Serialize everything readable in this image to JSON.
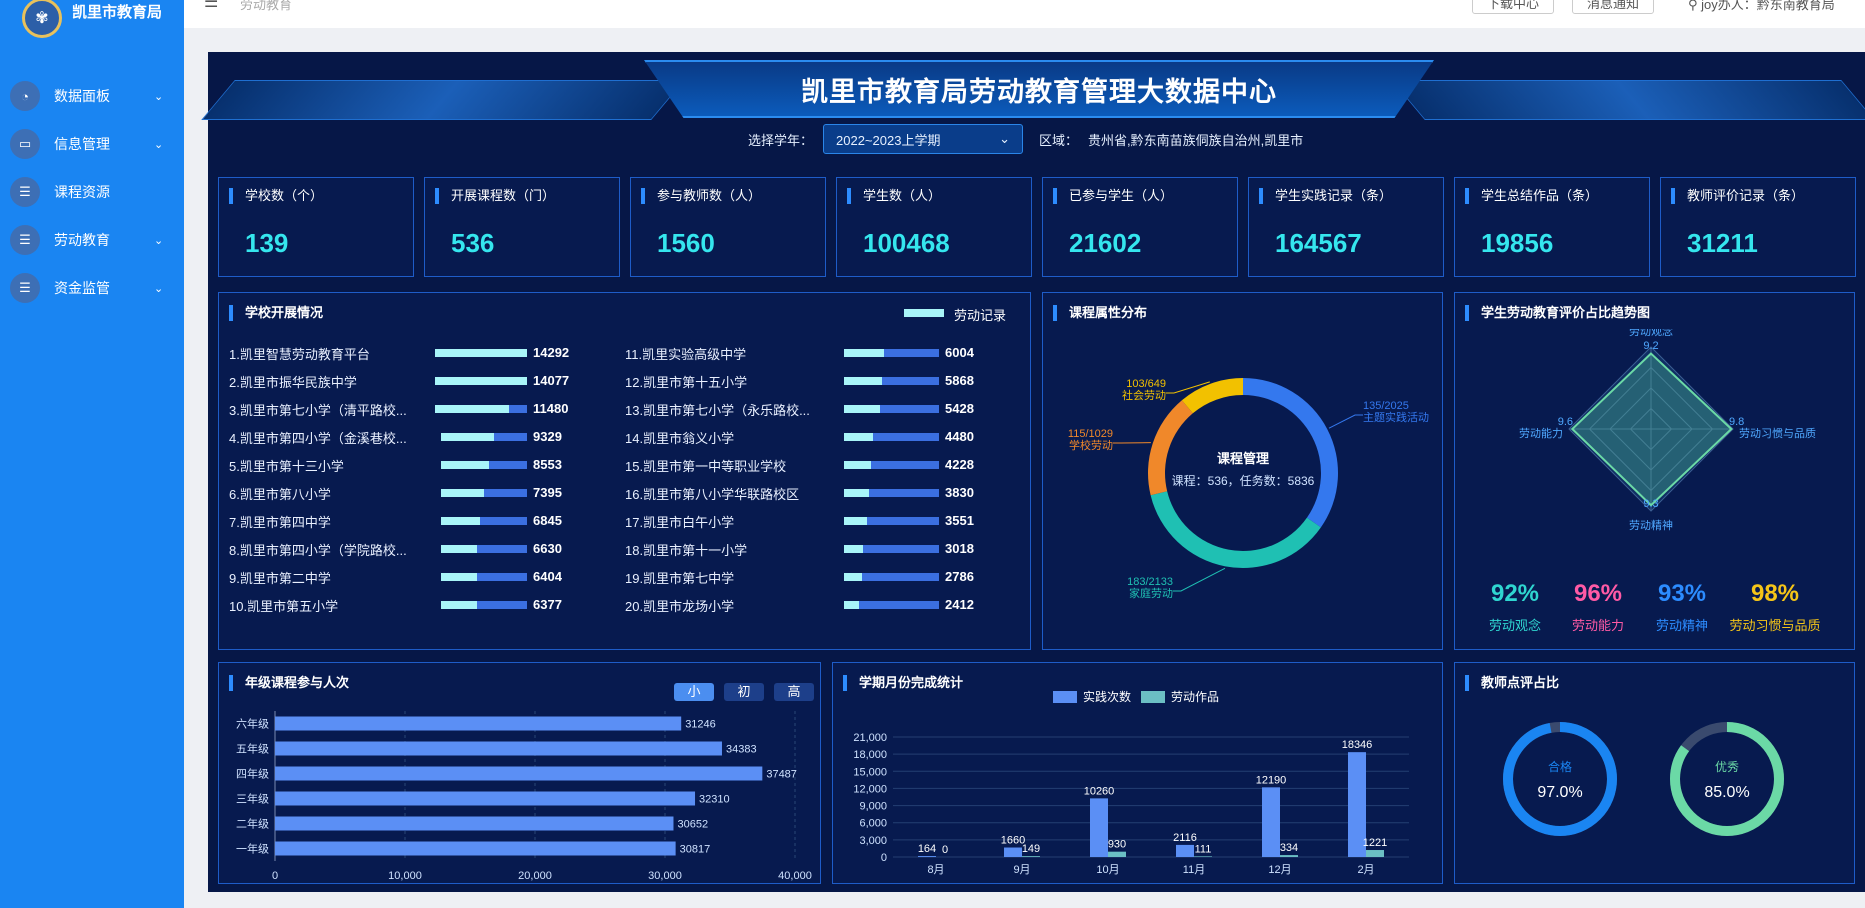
{
  "sidebar": {
    "logo_text": "凯里市教育局",
    "items": [
      {
        "label": "数据面板",
        "icon": "pie-chart-icon",
        "expandable": true
      },
      {
        "label": "信息管理",
        "icon": "monitor-icon",
        "expandable": true
      },
      {
        "label": "课程资源",
        "icon": "book-stack-icon",
        "expandable": false
      },
      {
        "label": "劳动教育",
        "icon": "book-stack-icon",
        "expandable": true
      },
      {
        "label": "资金监管",
        "icon": "book-stack-icon",
        "expandable": true
      }
    ]
  },
  "topbar": {
    "breadcrumb": "劳动教育",
    "download_label": "下载中心",
    "message_label": "消息通知",
    "user_label": "joy办人：黔东南教育局"
  },
  "header": {
    "title": "凯里市教育局劳动教育管理大数据中心",
    "year_label": "选择学年：",
    "year_value": "2022~2023上学期",
    "region_label": "区域：",
    "region_value": "贵州省,黔东南苗族侗族自治州,凯里市"
  },
  "stats": [
    {
      "label": "学校数（个）",
      "value": "139"
    },
    {
      "label": "开展课程数（门）",
      "value": "536"
    },
    {
      "label": "参与教师数（人）",
      "value": "1560"
    },
    {
      "label": "学生数（人）",
      "value": "100468"
    },
    {
      "label": "已参与学生（人）",
      "value": "21602"
    },
    {
      "label": "学生实践记录（条）",
      "value": "164567"
    },
    {
      "label": "学生总结作品（条）",
      "value": "19856"
    },
    {
      "label": "教师评价记录（条）",
      "value": "31211"
    }
  ],
  "school_panel": {
    "title": "学校开展情况",
    "legend": "劳动记录",
    "rows": [
      {
        "name": "1.凯里智慧劳动教育平台",
        "value": 14292,
        "fill": 1.0
      },
      {
        "name": "2.凯里市振华民族中学",
        "value": 14077,
        "fill": 1.0
      },
      {
        "name": "3.凯里市第七小学（清平路校...",
        "value": 11480,
        "fill": 0.8
      },
      {
        "name": "4.凯里市第四小学（金溪巷校...",
        "value": 9329,
        "fill": 0.65
      },
      {
        "name": "5.凯里市第十三小学",
        "value": 8553,
        "fill": 0.6
      },
      {
        "name": "6.凯里市第八小学",
        "value": 7395,
        "fill": 0.52
      },
      {
        "name": "7.凯里市第四中学",
        "value": 6845,
        "fill": 0.48
      },
      {
        "name": "8.凯里市第四小学（学院路校...",
        "value": 6630,
        "fill": 0.46
      },
      {
        "name": "9.凯里市第二中学",
        "value": 6404,
        "fill": 0.45
      },
      {
        "name": "10.凯里市第五小学",
        "value": 6377,
        "fill": 0.45
      },
      {
        "name": "11.凯里实验高级中学",
        "value": 6004,
        "fill": 0.42
      },
      {
        "name": "12.凯里市第十五小学",
        "value": 5868,
        "fill": 0.41
      },
      {
        "name": "13.凯里市第七小学（永乐路校...",
        "value": 5428,
        "fill": 0.38
      },
      {
        "name": "14.凯里市翁义小学",
        "value": 4480,
        "fill": 0.31
      },
      {
        "name": "15.凯里市第一中等职业学校",
        "value": 4228,
        "fill": 0.3
      },
      {
        "name": "16.凯里市第八小学华联路校区",
        "value": 3830,
        "fill": 0.27
      },
      {
        "name": "17.凯里市白午小学",
        "value": 3551,
        "fill": 0.25
      },
      {
        "name": "18.凯里市第十一小学",
        "value": 3018,
        "fill": 0.21
      },
      {
        "name": "19.凯里市第七中学",
        "value": 2786,
        "fill": 0.2
      },
      {
        "name": "20.凯里市龙场小学",
        "value": 2412,
        "fill": 0.17
      }
    ]
  },
  "course_panel": {
    "title": "课程属性分布",
    "center_title": "课程管理",
    "center_sub": "课程：536，任务数：5836",
    "segments": [
      {
        "label": "主题实践活动",
        "ratio": "135/2025",
        "value": 2025,
        "color": "#3478ee"
      },
      {
        "label": "家庭劳动",
        "ratio": "183/2133",
        "value": 2133,
        "color": "#1fc0b3"
      },
      {
        "label": "学校劳动",
        "ratio": "115/1029",
        "value": 1029,
        "color": "#f0882a"
      },
      {
        "label": "社会劳动",
        "ratio": "103/649",
        "value": 649,
        "color": "#f2c100"
      }
    ]
  },
  "radar_panel": {
    "title": "学生劳动教育评价占比趋势图",
    "axes": [
      {
        "label": "劳动观念",
        "value": 9.2
      },
      {
        "label": "劳动习惯与品质",
        "value": 9.8
      },
      {
        "label": "劳动精神",
        "value": 9.3
      },
      {
        "label": "劳动能力",
        "value": 9.6
      }
    ],
    "max": 10,
    "percents": [
      {
        "label": "劳动观念",
        "value": "92%",
        "color": "#2fd6d0"
      },
      {
        "label": "劳动能力",
        "value": "96%",
        "color": "#ff5aa5"
      },
      {
        "label": "劳动精神",
        "value": "93%",
        "color": "#2c8cff"
      },
      {
        "label": "劳动习惯与品质",
        "value": "98%",
        "color": "#f5c518"
      }
    ]
  },
  "grade_panel": {
    "title": "年级课程参与人次",
    "toggles": [
      "小",
      "初",
      "高"
    ],
    "active_toggle": 0
  },
  "month_panel": {
    "title": "学期月份完成统计"
  },
  "teacher_panel": {
    "title": "教师点评占比",
    "rings": [
      {
        "label": "合格",
        "value": "97.0%",
        "fraction": 0.97,
        "color": "#1a85f2"
      },
      {
        "label": "优秀",
        "value": "85.0%",
        "fraction": 0.85,
        "color": "#6bd9a6"
      }
    ]
  },
  "chart_data": [
    {
      "type": "bar",
      "orientation": "horizontal",
      "title": "年级课程参与人次",
      "categories": [
        "六年级",
        "五年级",
        "四年级",
        "三年级",
        "二年级",
        "一年级"
      ],
      "values": [
        31246,
        34383,
        37487,
        32310,
        30652,
        30817
      ],
      "xlim": [
        0,
        40000
      ],
      "xticks": [
        "0",
        "10,000",
        "20,000",
        "30,000",
        "40,000"
      ],
      "color": "#5b8ff5"
    },
    {
      "type": "bar",
      "title": "学期月份完成统计",
      "categories": [
        "8月",
        "9月",
        "10月",
        "11月",
        "12月",
        "2月"
      ],
      "series": [
        {
          "name": "实践次数",
          "values": [
            164,
            1660,
            10260,
            2116,
            12190,
            18346
          ],
          "color": "#5b8ff5"
        },
        {
          "name": "劳动作品",
          "values": [
            0,
            149,
            930,
            111,
            334,
            1221
          ],
          "color": "#6bbfc4"
        }
      ],
      "ylim": [
        0,
        21000
      ],
      "yticks": [
        "0",
        "3,000",
        "6,000",
        "9,000",
        "12,000",
        "15,000",
        "18,000",
        "21,000"
      ]
    }
  ]
}
